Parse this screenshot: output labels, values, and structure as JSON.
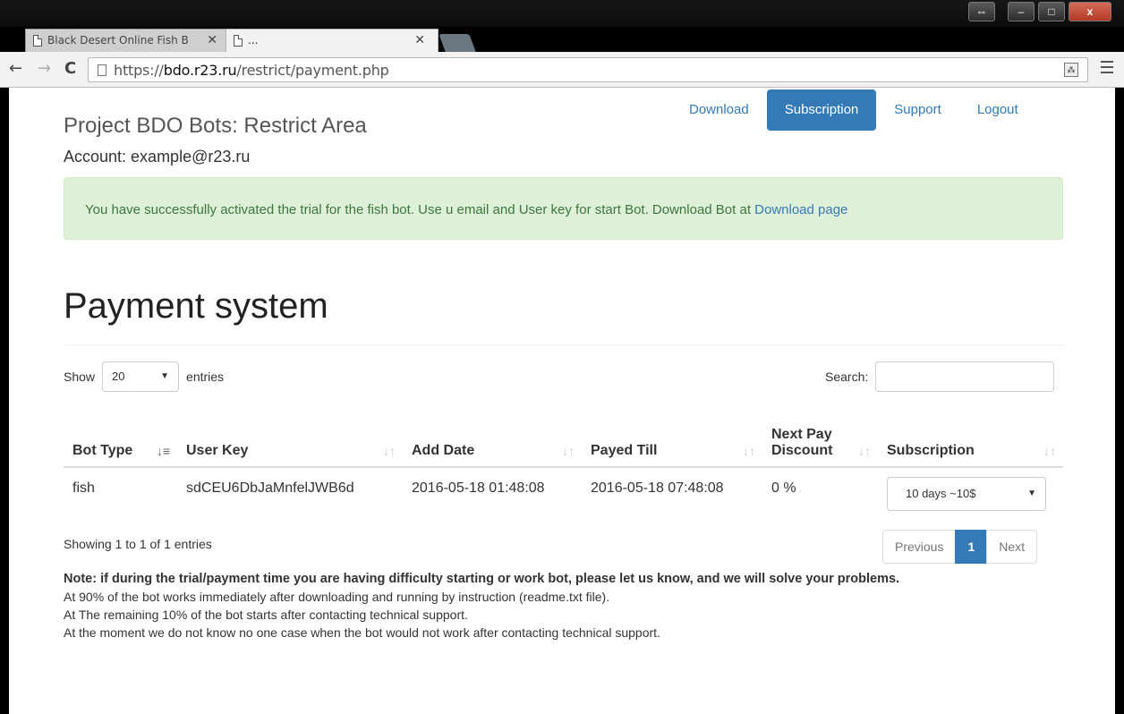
{
  "browser": {
    "tabs": [
      {
        "title": "Black Desert Online Fish B",
        "active": false
      },
      {
        "title": "...",
        "active": true
      }
    ],
    "url_prefix": "https://",
    "url_host": "bdo.r23.ru",
    "url_path": "/restrict/payment.php"
  },
  "header": {
    "brand": "Project BDO Bots: Restrict Area",
    "account": "Account: example@r23.ru",
    "nav": [
      {
        "label": "Download",
        "active": false
      },
      {
        "label": "Subscription",
        "active": true
      },
      {
        "label": "Support",
        "active": false
      },
      {
        "label": "Logout",
        "active": false
      }
    ]
  },
  "alert": {
    "text": "You have successfully activated the trial for the fish bot. Use u email and User key for start Bot. Download Bot at ",
    "link": "Download page"
  },
  "page_title": "Payment system",
  "table_controls": {
    "show_label": "Show",
    "entries_value": "20",
    "entries_label": "entries",
    "search_label": "Search:"
  },
  "table": {
    "headers": [
      "Bot Type",
      "User Key",
      "Add Date",
      "Payed Till",
      "Next Pay Discount",
      "Subscription"
    ],
    "rows": [
      {
        "bot_type": "fish",
        "user_key": "sdCEU6DbJaMnfelJWB6d",
        "add_date": "2016-05-18 01:48:08",
        "payed_till": "2016-05-18 07:48:08",
        "discount": "0 %",
        "subscription": "10 days ~10$"
      }
    ]
  },
  "footer": {
    "info": "Showing 1 to 1 of 1 entries",
    "pagination": {
      "prev": "Previous",
      "current": "1",
      "next": "Next"
    }
  },
  "notes": {
    "strong": "Note: if during the trial/payment time you are having difficulty starting or work bot, please let us know, and we will solve your problems.",
    "lines": [
      "At 90% of the bot works immediately after downloading and running by instruction (readme.txt file).",
      "At The remaining 10% of the bot starts after contacting technical support.",
      "At the moment we do not know no one case when the bot would not work after contacting technical support."
    ]
  },
  "colors": {
    "primary": "#337ab7",
    "alert_bg": "#dff0d8",
    "alert_text": "#3c763d"
  }
}
